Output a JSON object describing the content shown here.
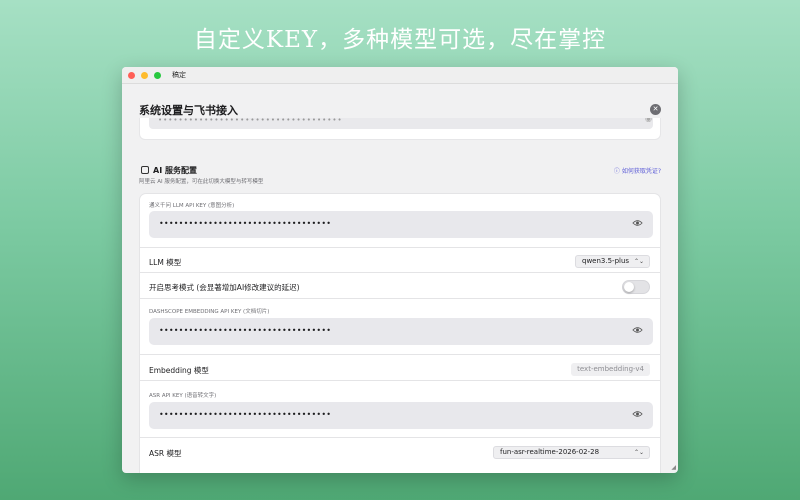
{
  "banner": {
    "text": "自定义KEY，多种模型可选，尽在掌控"
  },
  "window": {
    "title": "稿定"
  },
  "dialog": {
    "title": "系统设置与飞书接入"
  },
  "previous_section": {
    "masked_value": "••••••••••••••••••••••••••••••••••••"
  },
  "ai_section": {
    "title": "AI 服务配置",
    "subtitle": "阿里云 AI 服务配置，可在此切换大模型与转写模型",
    "help_link": "如何获取凭证?",
    "llm_key": {
      "caption": "通义千问 LLM API KEY (意图分析)",
      "masked_value": "•••••••••••••••••••••••••••••••••••"
    },
    "llm_model": {
      "label": "LLM 模型",
      "value": "qwen3.5-plus"
    },
    "thinking_mode": {
      "label": "开启思考模式 (会显著增加AI修改建议的延迟)",
      "enabled": false
    },
    "embedding_key": {
      "caption": "DASHSCOPE EMBEDDING API KEY (文档切片)",
      "masked_value": "•••••••••••••••••••••••••••••••••••"
    },
    "embedding_model": {
      "label": "Embedding 模型",
      "value": "text-embedding-v4"
    },
    "asr_key": {
      "caption": "ASR API KEY (语音转文字)",
      "masked_value": "•••••••••••••••••••••••••••••••••••"
    },
    "asr_model": {
      "label": "ASR 模型",
      "value": "fun-asr-realtime-2026-02-28"
    }
  },
  "colors": {
    "accent": "#5b5bd6",
    "background_top": "#a6e0c4",
    "background_bottom": "#4fa874"
  }
}
